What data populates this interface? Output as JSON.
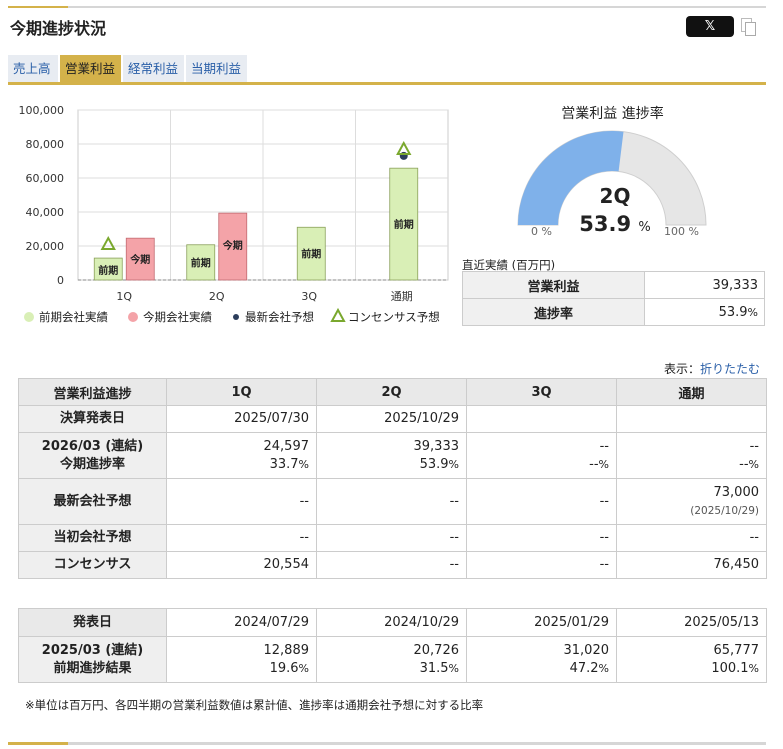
{
  "header": {
    "title": "今期進捗状況",
    "x_button": "𝕏",
    "copy_icon": "copy-icon"
  },
  "tabs": [
    {
      "label": "売上高",
      "active": false
    },
    {
      "label": "営業利益",
      "active": true
    },
    {
      "label": "経常利益",
      "active": false
    },
    {
      "label": "当期利益",
      "active": false
    }
  ],
  "colors": {
    "accent": "#d4b24a",
    "prev_bar": "#d9efb6",
    "curr_bar": "#f4a3a8",
    "forecast_dot": "#2c3e5c",
    "consensus": "#7aa82e",
    "gauge_fill": "#7fb1ea",
    "gauge_bg": "#e6e6e6",
    "link": "#2a5fa8"
  },
  "chart_data": {
    "type": "bar",
    "categories": [
      "1Q",
      "2Q",
      "3Q",
      "通期"
    ],
    "ylim": [
      0,
      100000
    ],
    "yticks": [
      "0",
      "20,000",
      "40,000",
      "60,000",
      "80,000",
      "100,000"
    ],
    "ytick_values": [
      0,
      20000,
      40000,
      60000,
      80000,
      100000
    ],
    "series": [
      {
        "name": "前期会社実績",
        "values": [
          12889,
          20726,
          31020,
          65777
        ],
        "bar_label": "前期"
      },
      {
        "name": "今期会社実績",
        "values": [
          24597,
          39333,
          null,
          null
        ],
        "bar_label": "今期"
      },
      {
        "name": "最新会社予想",
        "values": [
          null,
          null,
          null,
          73000
        ]
      },
      {
        "name": "コンセンサス予想",
        "values": [
          20554,
          null,
          null,
          76450
        ]
      }
    ],
    "grid": true,
    "legend_position": "bottom"
  },
  "gauge": {
    "title": "営業利益 進捗率",
    "quarter": "2Q",
    "value": "53.9",
    "fraction": 0.539,
    "unit": "%",
    "min_label": "0 %",
    "max_label": "100 %"
  },
  "recent": {
    "label": "直近実績 (百万円)",
    "rows": [
      {
        "label": "営業利益",
        "value": "39,333",
        "unit": ""
      },
      {
        "label": "進捗率",
        "value": "53.9",
        "unit": "%"
      }
    ]
  },
  "display_toggle": {
    "prefix": "表示：",
    "link": "折りたたむ"
  },
  "progress_table": {
    "headers": [
      "営業利益進捗",
      "1Q",
      "2Q",
      "3Q",
      "通期"
    ],
    "announce_label": "決算発表日",
    "announce_dates": [
      "2025/07/30",
      "2025/10/29",
      "",
      ""
    ],
    "current_label": "2026/03 (連結)",
    "current_sub_label": "今期進捗率",
    "current_values": [
      "24,597",
      "39,333",
      "--",
      "--"
    ],
    "current_rates": [
      "33.7",
      "53.9",
      "--",
      "--"
    ],
    "latest_label": "最新会社予想",
    "latest_values": [
      "--",
      "--",
      "--",
      "73,000"
    ],
    "latest_date": "(2025/10/29)",
    "initial_label": "当初会社予想",
    "initial_values": [
      "--",
      "--",
      "--",
      "--"
    ],
    "consensus_label": "コンセンサス",
    "consensus_values": [
      "20,554",
      "--",
      "--",
      "76,450"
    ]
  },
  "prev_table": {
    "date_label": "発表日",
    "dates": [
      "2024/07/29",
      "2024/10/29",
      "2025/01/29",
      "2025/05/13"
    ],
    "prev_label": "2025/03 (連結)",
    "prev_sub_label": "前期進捗結果",
    "prev_values": [
      "12,889",
      "20,726",
      "31,020",
      "65,777"
    ],
    "prev_rates": [
      "19.6",
      "31.5",
      "47.2",
      "100.1"
    ]
  },
  "footnote": "※単位は百万円、各四半期の営業利益数値は累計値、進捗率は通期会社予想に対する比率"
}
